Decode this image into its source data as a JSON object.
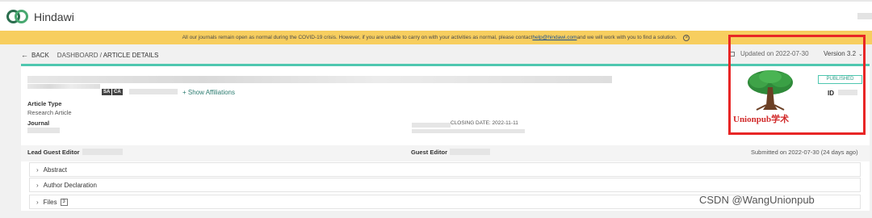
{
  "header": {
    "logo_text": "Hindawi"
  },
  "banner": {
    "text_before": "All our journals remain open as normal during the COVID-19 crisis. However, if you are unable to carry on with your activities as normal, please contact ",
    "link": "help@hindawi.com",
    "text_after": " and we will work with you to find a solution.",
    "close_icon": "ⓧ",
    "color": "#f7ce5f"
  },
  "nav": {
    "back_label": "BACK",
    "breadcrumb_parent": "DASHBOARD",
    "breadcrumb_sep": " / ",
    "breadcrumb_current": "ARTICLE DETAILS",
    "updated_label": "Updated on 2022-07-30",
    "version_label": "Version 3.2"
  },
  "article": {
    "author_tags": [
      "SA",
      "CA"
    ],
    "show_affiliations": "+ Show Affiliations",
    "article_type_label": "Article Type",
    "article_type_value": "Research Article",
    "journal_label": "Journal",
    "closing_date": "CLOSING DATE: 2022-11-11",
    "status": "PUBLISHED",
    "id_label": "ID",
    "accent_color": "#4fc7b0"
  },
  "editors": {
    "lead_label": "Lead Guest Editor",
    "guest_label": "Guest Editor",
    "submitted": "Submitted on 2022-07-30 (24 days ago)"
  },
  "sections": [
    {
      "label": "Abstract"
    },
    {
      "label": "Author Declaration"
    },
    {
      "label": "Files",
      "count": "3"
    }
  ],
  "overlay": {
    "watermark": "Unionpub学术",
    "csdn": "CSDN @WangUnionpub",
    "box_color": "#e82626"
  }
}
